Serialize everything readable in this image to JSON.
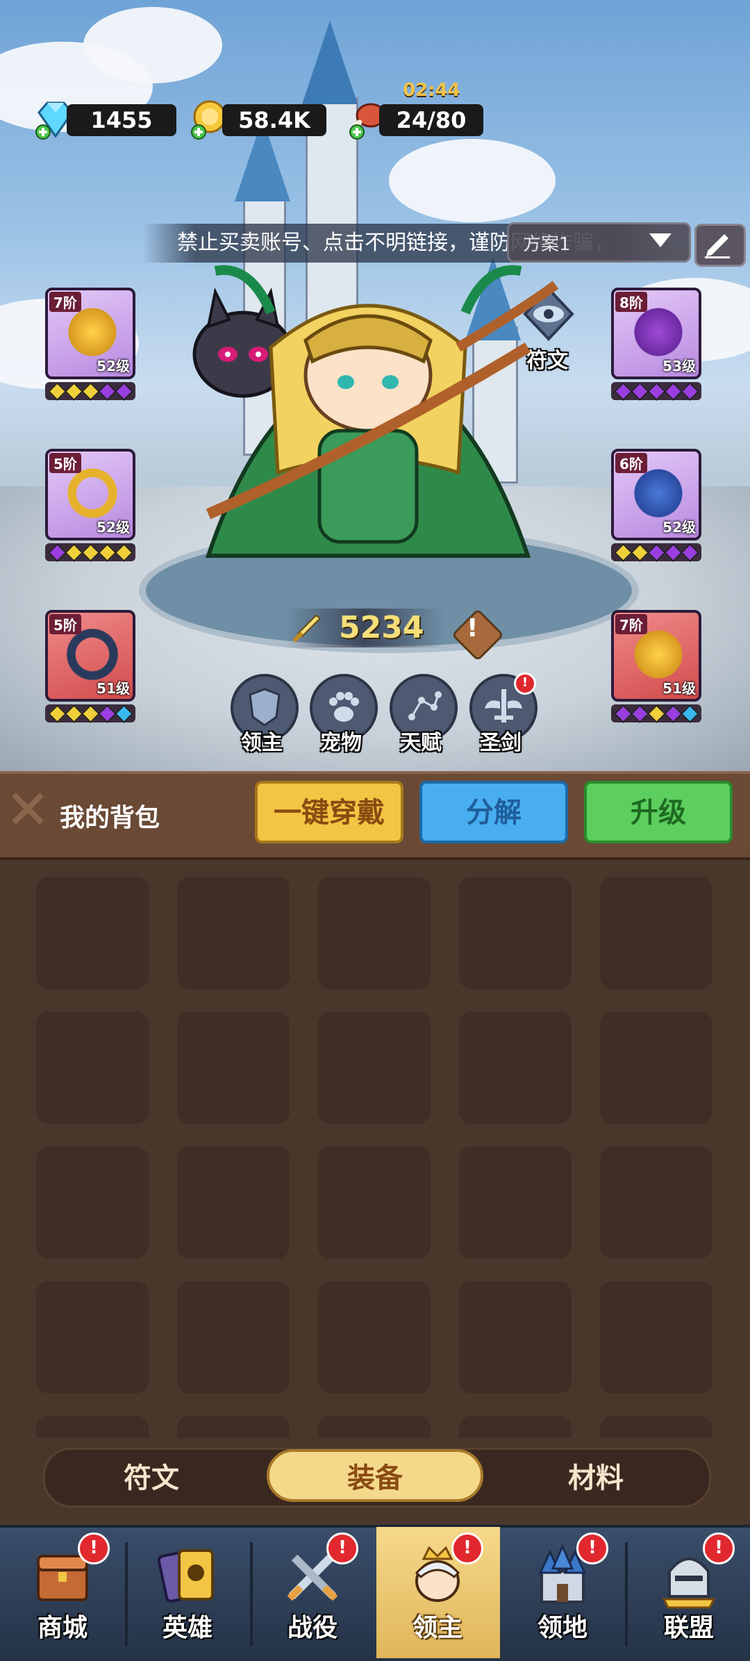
{
  "resources": {
    "diamonds": "1455",
    "gold": "58.4K",
    "stamina": "24/80",
    "stamina_timer": "02:44"
  },
  "notice_text": "禁止买卖账号、点击不明链接，谨防网络诈骗，",
  "preset_label": "方案1",
  "rune_label": "符文",
  "equipment_slots": [
    {
      "tier": "7阶",
      "level": "52级",
      "gems": [
        "y",
        "y",
        "y",
        "p",
        "p"
      ],
      "color": "purple"
    },
    {
      "tier": "5阶",
      "level": "52级",
      "gems": [
        "p",
        "y",
        "y",
        "y",
        "y"
      ],
      "color": "purple"
    },
    {
      "tier": "5阶",
      "level": "51级",
      "gems": [
        "y",
        "y",
        "y",
        "p",
        "b"
      ],
      "color": "red"
    },
    {
      "tier": "8阶",
      "level": "53级",
      "gems": [
        "p",
        "p",
        "p",
        "p",
        "p"
      ],
      "color": "purple"
    },
    {
      "tier": "6阶",
      "level": "52级",
      "gems": [
        "y",
        "y",
        "p",
        "p",
        "p"
      ],
      "color": "purple"
    },
    {
      "tier": "7阶",
      "level": "51级",
      "gems": [
        "p",
        "p",
        "y",
        "p",
        "b"
      ],
      "color": "red"
    }
  ],
  "power": "5234",
  "character_buttons": {
    "lord": "领主",
    "pet": "宠物",
    "talent": "天赋",
    "holy_sword": "圣剑"
  },
  "backpack": {
    "title": "我的背包",
    "equip_all": "一键穿戴",
    "disassemble": "分解",
    "upgrade": "升级"
  },
  "tabs": {
    "rune": "符文",
    "equipment": "装备",
    "material": "材料",
    "active": "装备"
  },
  "nav": {
    "shop": "商城",
    "heroes": "英雄",
    "campaign": "战役",
    "lord": "领主",
    "territory": "领地",
    "alliance": "联盟",
    "active": "领主"
  },
  "colors": {
    "equip_button": "#f2c544",
    "disassemble_button": "#48aef0",
    "upgrade_button": "#5ccf5e",
    "alert_red": "#e0282e"
  }
}
